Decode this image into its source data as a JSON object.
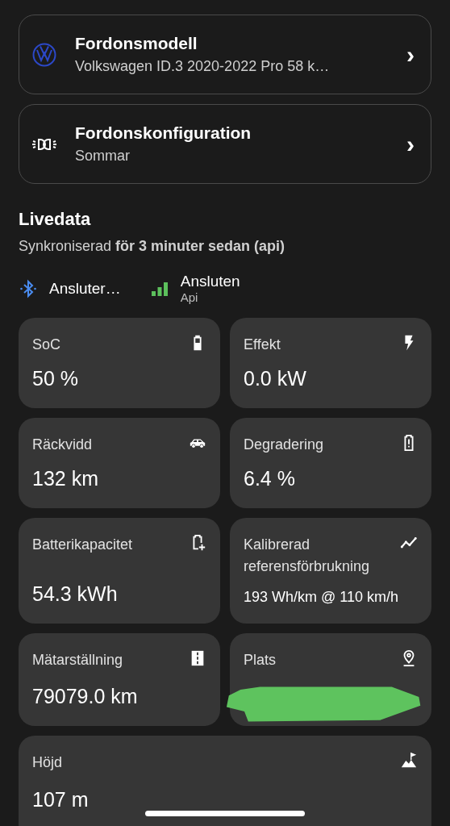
{
  "settings": [
    {
      "title": "Fordonsmodell",
      "subtitle": "Volkswagen ID.3 2020-2022 Pro 58 k…",
      "chevron": "›"
    },
    {
      "title": "Fordonskonfiguration",
      "subtitle": "Sommar",
      "chevron": "›"
    }
  ],
  "livedata": {
    "title": "Livedata",
    "sync": "Synkroniserad **för 3 minuter sedan (api)**",
    "connections": [
      {
        "kind": "bluetooth",
        "label": "Ansluter…"
      },
      {
        "kind": "signal",
        "label": "Ansluten",
        "sublabel": "Api"
      }
    ]
  },
  "tiles": [
    {
      "kind": "metric",
      "label": "SoC",
      "value": "50 %"
    },
    {
      "kind": "metric",
      "label": "Effekt",
      "value": "0.0 kW"
    },
    {
      "kind": "metric",
      "label": "Räckvidd",
      "value": "132 km"
    },
    {
      "kind": "metric",
      "label": "Degradering",
      "value": "6.4 %"
    },
    {
      "kind": "metric",
      "label": "Batterikapacitet",
      "value": "54.3 kWh"
    },
    {
      "kind": "detail",
      "label": "Kalibrerad referensförbrukning",
      "value": "193 Wh/km @ 110 km/h"
    },
    {
      "kind": "metric",
      "label": "Mätarställning",
      "value": "79079.0 km"
    },
    {
      "kind": "redacted",
      "label": "Plats"
    },
    {
      "kind": "wide",
      "label": "Höjd",
      "value": "107 m"
    }
  ]
}
